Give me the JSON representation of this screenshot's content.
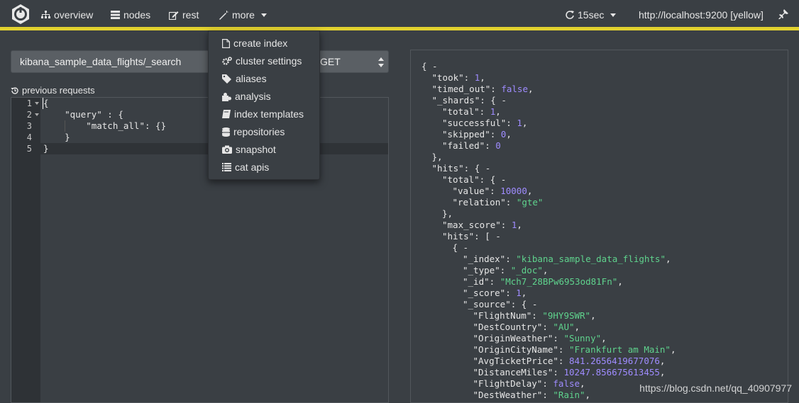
{
  "nav": {
    "overview": "overview",
    "nodes": "nodes",
    "rest": "rest",
    "more": "more",
    "refresh": "15sec",
    "cluster": "http://localhost:9200 [yellow]"
  },
  "colors": {
    "accent": "#e2d12f",
    "string": "#5fd38d",
    "number": "#9f8cff"
  },
  "request": {
    "url": "kibana_sample_data_flights/_search",
    "method": "GET",
    "previous": "previous requests"
  },
  "editor": {
    "line_numbers": [
      "1",
      "2",
      "3",
      "4",
      "5"
    ],
    "lines": [
      "{",
      "    \"query\" : {",
      "        \"match_all\": {}",
      "    }",
      "}"
    ]
  },
  "menu": {
    "items": [
      {
        "label": "create index",
        "icon": "file-icon"
      },
      {
        "label": "cluster settings",
        "icon": "cogs-icon"
      },
      {
        "label": "aliases",
        "icon": "tags-icon"
      },
      {
        "label": "analysis",
        "icon": "puzzle-icon"
      },
      {
        "label": "index templates",
        "icon": "book-icon"
      },
      {
        "label": "repositories",
        "icon": "database-icon"
      },
      {
        "label": "snapshot",
        "icon": "camera-icon"
      },
      {
        "label": "cat apis",
        "icon": "list-icon"
      }
    ]
  },
  "response": {
    "lines": [
      [
        [
          "{ -",
          "k"
        ]
      ],
      [
        [
          "\"took\": ",
          "k"
        ],
        [
          "1",
          "n"
        ],
        [
          ",",
          "k"
        ]
      ],
      [
        [
          "\"timed_out\": ",
          "k"
        ],
        [
          "false",
          "b"
        ],
        [
          ",",
          "k"
        ]
      ],
      [
        [
          "\"_shards\": { -",
          "k"
        ]
      ],
      [
        [
          "\"total\": ",
          "k"
        ],
        [
          "1",
          "n"
        ],
        [
          ",",
          "k"
        ]
      ],
      [
        [
          "\"successful\": ",
          "k"
        ],
        [
          "1",
          "n"
        ],
        [
          ",",
          "k"
        ]
      ],
      [
        [
          "\"skipped\": ",
          "k"
        ],
        [
          "0",
          "n"
        ],
        [
          ",",
          "k"
        ]
      ],
      [
        [
          "\"failed\": ",
          "k"
        ],
        [
          "0",
          "n"
        ]
      ],
      [
        [
          "},",
          "k"
        ]
      ],
      [
        [
          "\"hits\": { -",
          "k"
        ]
      ],
      [
        [
          "\"total\": { -",
          "k"
        ]
      ],
      [
        [
          "\"value\": ",
          "k"
        ],
        [
          "10000",
          "n"
        ],
        [
          ",",
          "k"
        ]
      ],
      [
        [
          "\"relation\": ",
          "k"
        ],
        [
          "\"gte\"",
          "s"
        ]
      ],
      [
        [
          "},",
          "k"
        ]
      ],
      [
        [
          "\"max_score\": ",
          "k"
        ],
        [
          "1",
          "n"
        ],
        [
          ",",
          "k"
        ]
      ],
      [
        [
          "\"hits\": [ -",
          "k"
        ]
      ],
      [
        [
          "{ -",
          "k"
        ]
      ],
      [
        [
          "\"_index\": ",
          "k"
        ],
        [
          "\"kibana_sample_data_flights\"",
          "s"
        ],
        [
          ",",
          "k"
        ]
      ],
      [
        [
          "\"_type\": ",
          "k"
        ],
        [
          "\"_doc\"",
          "s"
        ],
        [
          ",",
          "k"
        ]
      ],
      [
        [
          "\"_id\": ",
          "k"
        ],
        [
          "\"Mch7_28BPw6953od81Fn\"",
          "s"
        ],
        [
          ",",
          "k"
        ]
      ],
      [
        [
          "\"_score\": ",
          "k"
        ],
        [
          "1",
          "n"
        ],
        [
          ",",
          "k"
        ]
      ],
      [
        [
          "\"_source\": { -",
          "k"
        ]
      ],
      [
        [
          "\"FlightNum\": ",
          "k"
        ],
        [
          "\"9HY9SWR\"",
          "s"
        ],
        [
          ",",
          "k"
        ]
      ],
      [
        [
          "\"DestCountry\": ",
          "k"
        ],
        [
          "\"AU\"",
          "s"
        ],
        [
          ",",
          "k"
        ]
      ],
      [
        [
          "\"OriginWeather\": ",
          "k"
        ],
        [
          "\"Sunny\"",
          "s"
        ],
        [
          ",",
          "k"
        ]
      ],
      [
        [
          "\"OriginCityName\": ",
          "k"
        ],
        [
          "\"Frankfurt am Main\"",
          "s"
        ],
        [
          ",",
          "k"
        ]
      ],
      [
        [
          "\"AvgTicketPrice\": ",
          "k"
        ],
        [
          "841.2656419677076",
          "n"
        ],
        [
          ",",
          "k"
        ]
      ],
      [
        [
          "\"DistanceMiles\": ",
          "k"
        ],
        [
          "10247.856675613455",
          "n"
        ],
        [
          ",",
          "k"
        ]
      ],
      [
        [
          "\"FlightDelay\": ",
          "k"
        ],
        [
          "false",
          "b"
        ],
        [
          ",",
          "k"
        ]
      ],
      [
        [
          "\"DestWeather\": ",
          "k"
        ],
        [
          "\"Rain\"",
          "s"
        ],
        [
          ",",
          "k"
        ]
      ]
    ]
  },
  "watermark": "https://blog.csdn.net/qq_40907977"
}
